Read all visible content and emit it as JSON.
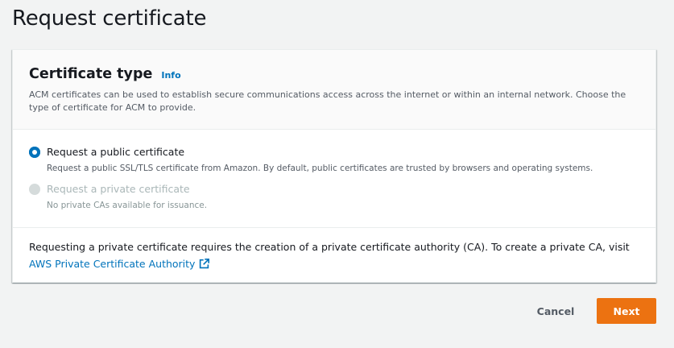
{
  "page": {
    "title": "Request certificate"
  },
  "panel": {
    "title": "Certificate type",
    "info_label": "Info",
    "description": "ACM certificates can be used to establish secure communications access across the internet or within an internal network. Choose the type of certificate for ACM to provide."
  },
  "options": [
    {
      "label": "Request a public certificate",
      "description": "Request a public SSL/TLS certificate from Amazon. By default, public certificates are trusted by browsers and operating systems.",
      "selected": true,
      "disabled": false
    },
    {
      "label": "Request a private certificate",
      "description": "No private CAs available for issuance.",
      "selected": false,
      "disabled": true
    }
  ],
  "notice": {
    "text": "Requesting a private certificate requires the creation of a private certificate authority (CA). To create a private CA, visit",
    "link_label": "AWS Private Certificate Authority",
    "link_icon": "external-link-icon"
  },
  "actions": {
    "cancel_label": "Cancel",
    "next_label": "Next"
  },
  "colors": {
    "accent": "#0073bb",
    "primary_button": "#ec7211",
    "background": "#f2f3f3"
  }
}
